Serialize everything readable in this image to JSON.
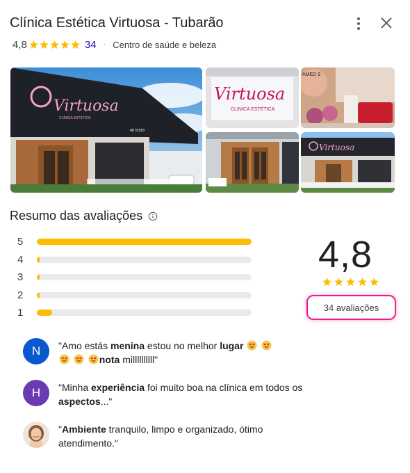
{
  "header": {
    "title": "Clínica Estética Virtuosa - Tubarão",
    "rating": "4,8",
    "review_count": "34",
    "separator": "·",
    "category": "Centro de saúde e beleza"
  },
  "colors": {
    "star": "#fbbc04",
    "link": "#1a0dab",
    "highlight": "#e91e8c",
    "avatar_n": "#0b57d0",
    "avatar_h": "#6a3ab2"
  },
  "icons": {
    "menu": "more-vert-icon",
    "close": "close-icon",
    "info": "info-icon",
    "star": "star-icon",
    "emoji": "heart-eyes-emoji-icon"
  },
  "photos": {
    "main_sign": "Virtuosa",
    "main_small_text": "CLÍNICA ESTÉTICA",
    "main_number": "48  31918",
    "sign_text": "Virtuosa",
    "sign_sub": "CLÍNICA ESTÉTICA",
    "balloon_text": "AMED 9"
  },
  "summary": {
    "title": "Resumo das avaliações",
    "average": "4,8",
    "reviews_button": "34 avaliações",
    "bars": [
      {
        "stars": "5",
        "fraction": 1.0
      },
      {
        "stars": "4",
        "fraction": 0.005
      },
      {
        "stars": "3",
        "fraction": 0.005
      },
      {
        "stars": "2",
        "fraction": 0.005
      },
      {
        "stars": "1",
        "fraction": 0.07
      }
    ]
  },
  "reviews": [
    {
      "initial": "N",
      "parts": [
        "\"Amo estás ",
        "menina",
        " estou no melhor ",
        "lugar",
        "nota",
        " millllllllll\""
      ]
    },
    {
      "initial": "H",
      "parts": [
        "\"Minha ",
        "experiência",
        " foi muito boa na clínica em todos os ",
        "aspectos",
        "...\""
      ]
    },
    {
      "initial": "",
      "parts": [
        "\"",
        "Ambiente",
        " tranquilo, limpo e organizado, ótimo atendimento.\""
      ]
    }
  ]
}
